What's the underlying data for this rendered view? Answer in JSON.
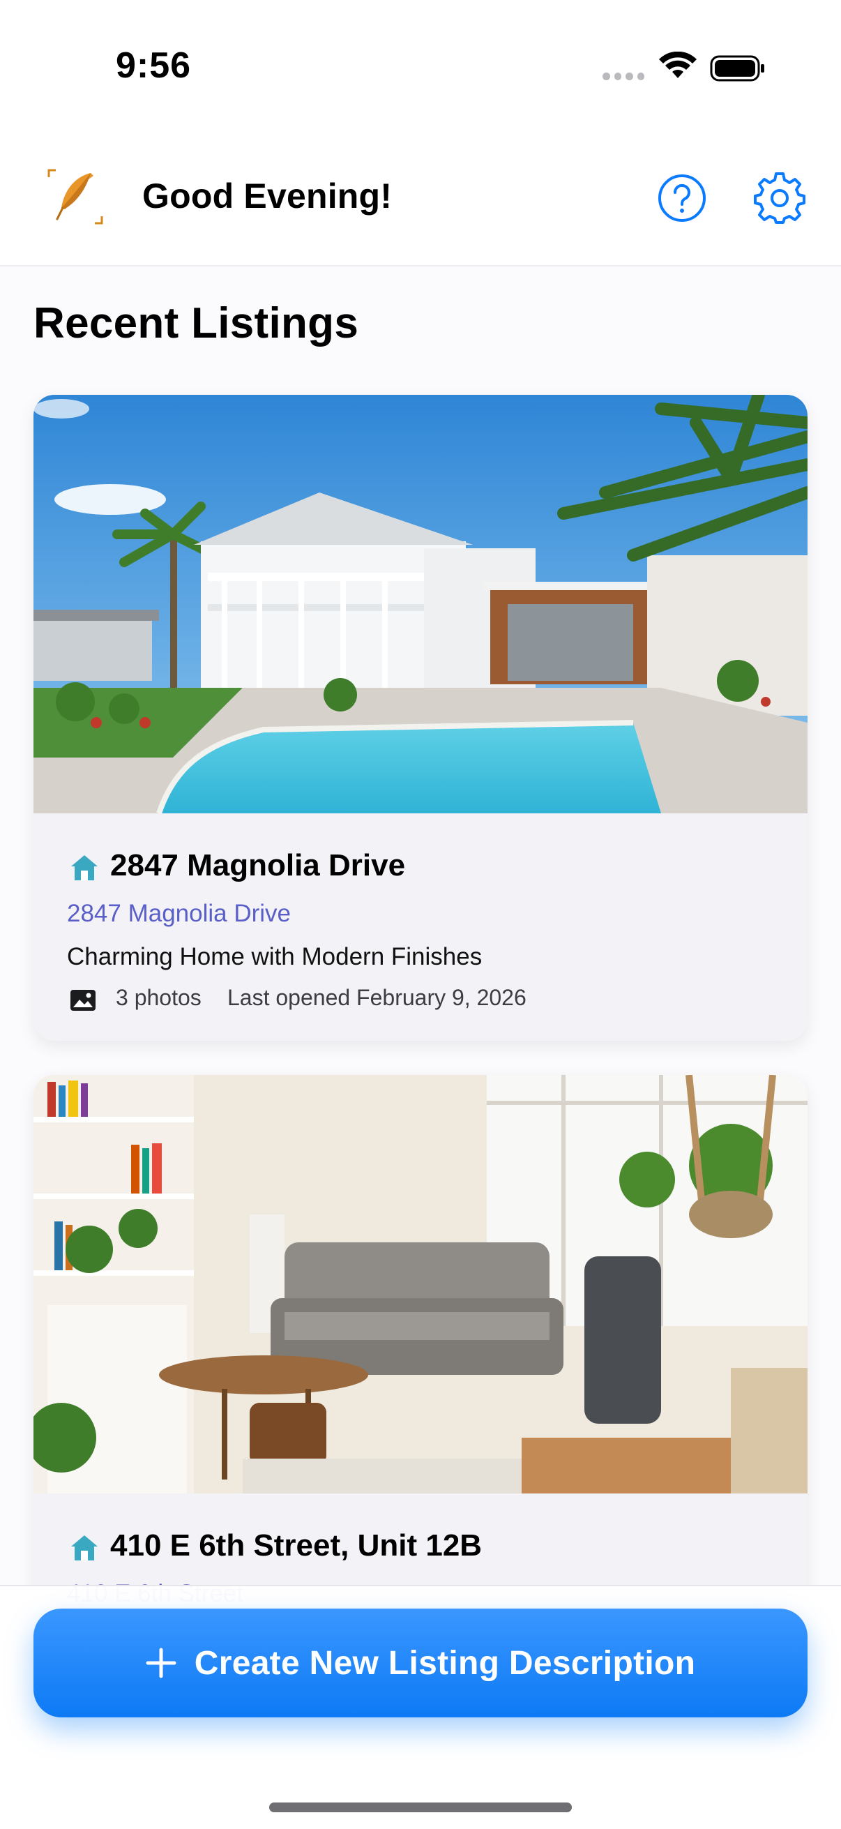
{
  "status_bar": {
    "time": "9:56"
  },
  "header": {
    "greeting": "Good Evening!",
    "icons": [
      "app-logo-quill-icon",
      "help-icon",
      "gear-icon"
    ],
    "accent_color": "#0a7aff"
  },
  "main": {
    "section_title": "Recent Listings",
    "listings": [
      {
        "title": "2847 Magnolia Drive",
        "address": "2847 Magnolia Drive",
        "description": "Charming Home with Modern Finishes",
        "photos": "3 photos",
        "last_opened": "Last opened February 9, 2026",
        "image": "house-with-pool-photo"
      },
      {
        "title": "410 E 6th Street, Unit 12B",
        "address": "410 E 6th Street",
        "image": "living-room-photo"
      }
    ]
  },
  "bottom": {
    "create_label": "Create New Listing Description",
    "button_color": "#0a7aff"
  },
  "colors": {
    "address_link": "#5a5fc8",
    "house_icon": "#3aa8c1",
    "card_background": "#f2f2f7"
  }
}
